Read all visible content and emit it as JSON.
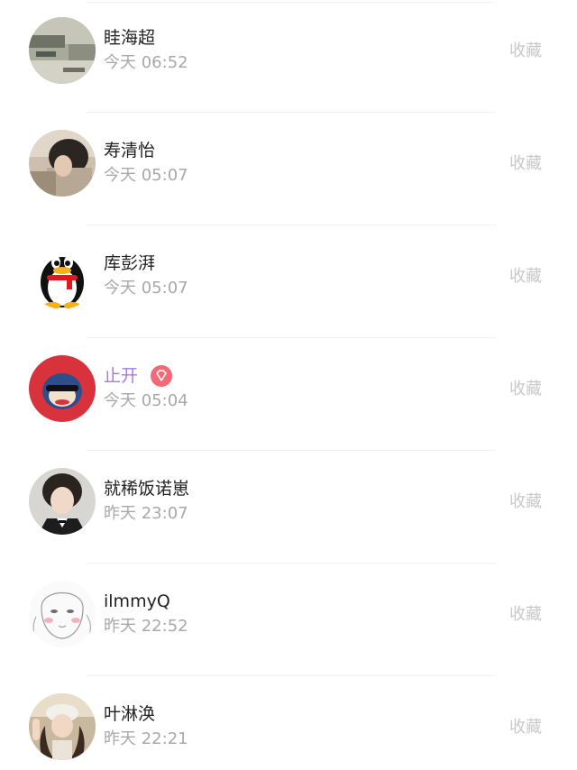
{
  "items": [
    {
      "name": "眭海超",
      "time": "今天 06:52",
      "action": "收藏",
      "avatar": "photo-avatar-icon"
    },
    {
      "name": "寿清怡",
      "time": "今天 05:07",
      "action": "收藏",
      "avatar": "photo-avatar-icon"
    },
    {
      "name": "库彭湃",
      "time": "今天 05:07",
      "action": "收藏",
      "avatar": "penguin-avatar-icon"
    },
    {
      "name": "止开",
      "time": "今天 05:04",
      "action": "收藏",
      "avatar": "monkey-avatar-icon",
      "vip": true,
      "name_color": "#a678e8",
      "badge_color": "#f26a76"
    },
    {
      "name": "就稀饭诺崽",
      "time": "昨天 23:07",
      "action": "收藏",
      "avatar": "photo-avatar-icon"
    },
    {
      "name": "ilmmyQ",
      "time": "昨天 22:52",
      "action": "收藏",
      "avatar": "sketch-avatar-icon"
    },
    {
      "name": "叶淋涣",
      "time": "昨天 22:21",
      "action": "收藏",
      "avatar": "photo-avatar-icon"
    }
  ]
}
